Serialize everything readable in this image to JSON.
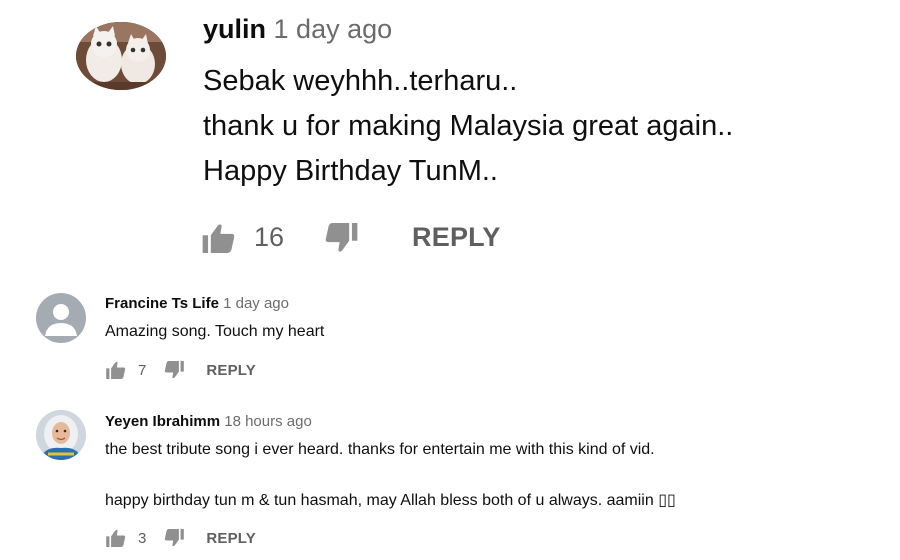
{
  "comments": [
    {
      "author": "yulin",
      "time": "1 day ago",
      "lines": [
        "Sebak weyhhh..terharu..",
        "thank u for making Malaysia great again..",
        "Happy Birthday TunM.."
      ],
      "likes": "16",
      "reply_label": "REPLY",
      "avatar_icon": "cats-photo-avatar"
    },
    {
      "author": "Francine Ts Life",
      "time": "1 day ago",
      "lines": [
        "Amazing song. Touch my heart"
      ],
      "likes": "7",
      "reply_label": "REPLY",
      "avatar_icon": "default-user-avatar"
    },
    {
      "author": "Yeyen Ibrahimm",
      "time": "18 hours ago",
      "lines": [
        "the best tribute song i ever heard. thanks for entertain me with this kind of vid.",
        "happy birthday tun m & tun hasmah, may Allah bless both of u always. aamiin ▯▯"
      ],
      "likes": "3",
      "reply_label": "REPLY",
      "avatar_icon": "hijab-woman-photo-avatar"
    }
  ],
  "colors": {
    "text": "#0f0f0f",
    "secondary": "#6b6b6b",
    "icon": "#909090",
    "avatar_default": "#a4abb3"
  }
}
